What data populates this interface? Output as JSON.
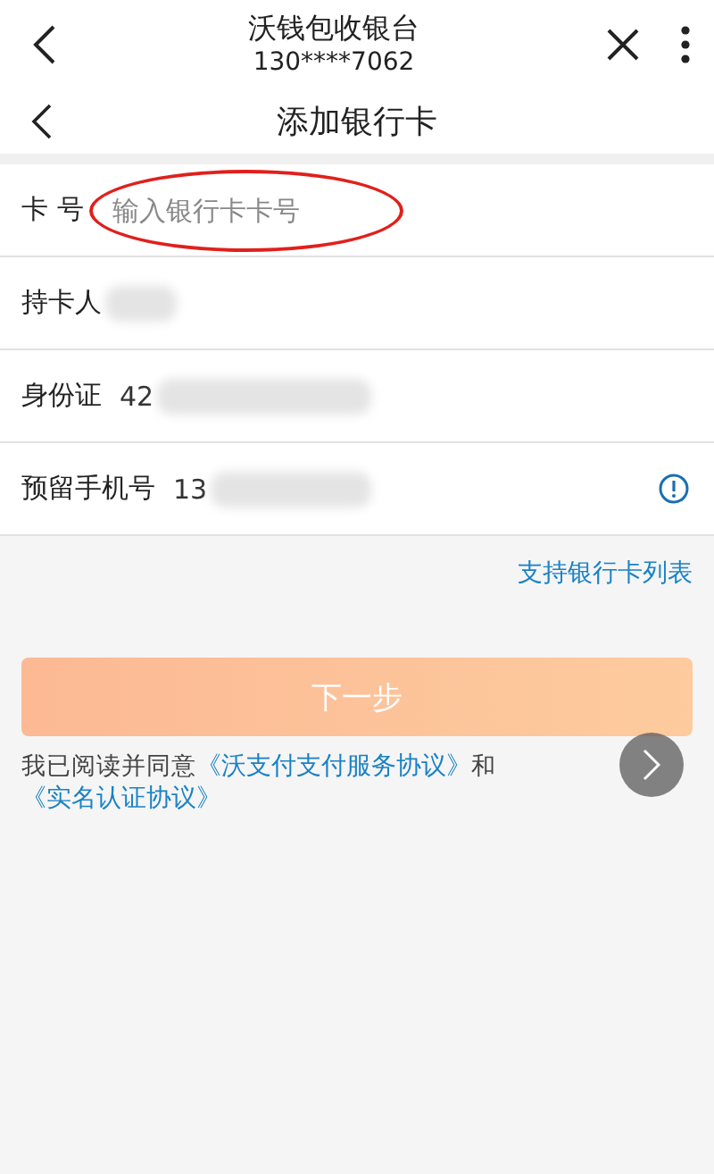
{
  "header": {
    "title": "沃钱包收银台",
    "subtitle": "130****7062"
  },
  "nav": {
    "title": "添加银行卡"
  },
  "fields": [
    {
      "label": "卡 号",
      "placeholder": "输入银行卡卡号",
      "kind": "input",
      "annotated": true
    },
    {
      "label": "持卡人",
      "kind": "redacted",
      "annotated": false
    },
    {
      "label": "身份证",
      "value": "42",
      "kind": "redacted",
      "annotated": false
    },
    {
      "label": "预留手机号",
      "value": "13",
      "kind": "redacted-info",
      "annotated": false
    }
  ],
  "support_link": "支持银行卡列表",
  "next_button": {
    "label": "下一步",
    "disabled": true
  },
  "agreement": {
    "prefix": "我已阅读并同意",
    "link_1": "《沃支付支付服务协议》",
    "middle": "和",
    "link_2": "《实名认证协议》"
  }
}
